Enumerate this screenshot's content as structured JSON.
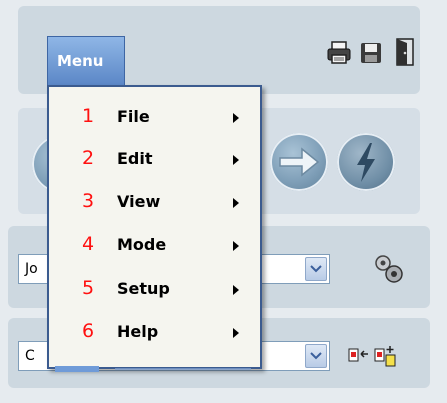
{
  "toolbar": {
    "menu_label": "Menu",
    "icons": [
      "printer-icon",
      "save-icon",
      "exit-door-icon"
    ]
  },
  "menu": {
    "items": [
      {
        "number": "1",
        "label": "File"
      },
      {
        "number": "2",
        "label": "Edit"
      },
      {
        "number": "3",
        "label": "View"
      },
      {
        "number": "4",
        "label": "Mode"
      },
      {
        "number": "5",
        "label": "Setup"
      },
      {
        "number": "6",
        "label": "Help"
      }
    ]
  },
  "combos": {
    "first_value": "Jo",
    "second_value": "C"
  },
  "colors": {
    "menu_number": "#ff1010",
    "menu_button": "#5a86c6",
    "menu_border": "#3b5b8f"
  }
}
